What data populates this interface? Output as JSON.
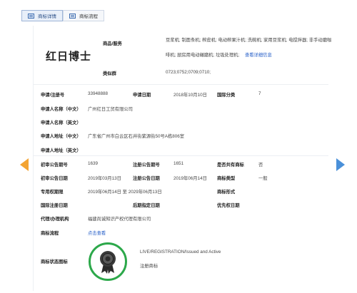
{
  "tabs": [
    {
      "label": "商标详情",
      "active": true
    },
    {
      "label": "商标流程",
      "active": false
    }
  ],
  "logo_text": "红日博士",
  "goods": {
    "label": "商品/服务",
    "line1": "豆浆机; 制面条机; 榨皮机; 电动榨果汁机; 洗碗机; 家用豆浆机; 电搅拌器; 非手动磨咖",
    "line2_text": "啡机; 厨房用电动碾磨机; 垃圾处理机;",
    "line2_link": "查看详细信息"
  },
  "class_group": {
    "label": "类似群",
    "value": "0723;0752;0709;0710;"
  },
  "rows": {
    "reg_no": {
      "label": "申请/注册号",
      "value": "33948888"
    },
    "apply_date": {
      "label": "申请日期",
      "value": "2018年10月10日"
    },
    "intl_class": {
      "label": "国际分类",
      "value": "7"
    },
    "applicant_cn": {
      "label": "申请人名称（中文）",
      "value": "广州红日工贸有限公司"
    },
    "applicant_en": {
      "label": "申请人名称（英文）",
      "value": ""
    },
    "address_cn": {
      "label": "申请人地址（中文）",
      "value": "广东省广州市白云区石井街紫源街50号A栋806室"
    },
    "address_en": {
      "label": "申请人地址（英文）",
      "value": ""
    },
    "prelim_no": {
      "label": "初审公告期号",
      "value": "1639"
    },
    "reg_pub_no": {
      "label": "注册公告期号",
      "value": "1651"
    },
    "shared": {
      "label": "是否共有商标",
      "value": "否"
    },
    "prelim_date": {
      "label": "初审公告日期",
      "value": "2019年03月13日"
    },
    "reg_pub_date": {
      "label": "注册公告日期",
      "value": "2019年06月14日"
    },
    "tm_type": {
      "label": "商标类型",
      "value": "一般"
    },
    "exclusive": {
      "label": "专用权期限",
      "value": "2019年06月14日 至 2029年06月13日"
    },
    "tm_form": {
      "label": "商标形式",
      "value": ""
    },
    "intl_reg_date": {
      "label": "国际注册日期",
      "value": ""
    },
    "later_date": {
      "label": "后期指定日期",
      "value": ""
    },
    "priority_date": {
      "label": "优先权日期",
      "value": ""
    },
    "agent": {
      "label": "代理/办理机构",
      "value": "福建尚诚知识产权代理有限公司"
    },
    "process": {
      "label": "商标流程",
      "value": "点击查看"
    },
    "status": {
      "label": "商标状态图标",
      "value_en": "LIVE/REGISTRATION/Issued and Active",
      "value_cn": "注册商标"
    }
  },
  "colors": {
    "accent": "#2a62c9",
    "badge_ring": "#2ca84a",
    "arrow_left": "#f3a433",
    "arrow_right": "#4a90d9"
  }
}
